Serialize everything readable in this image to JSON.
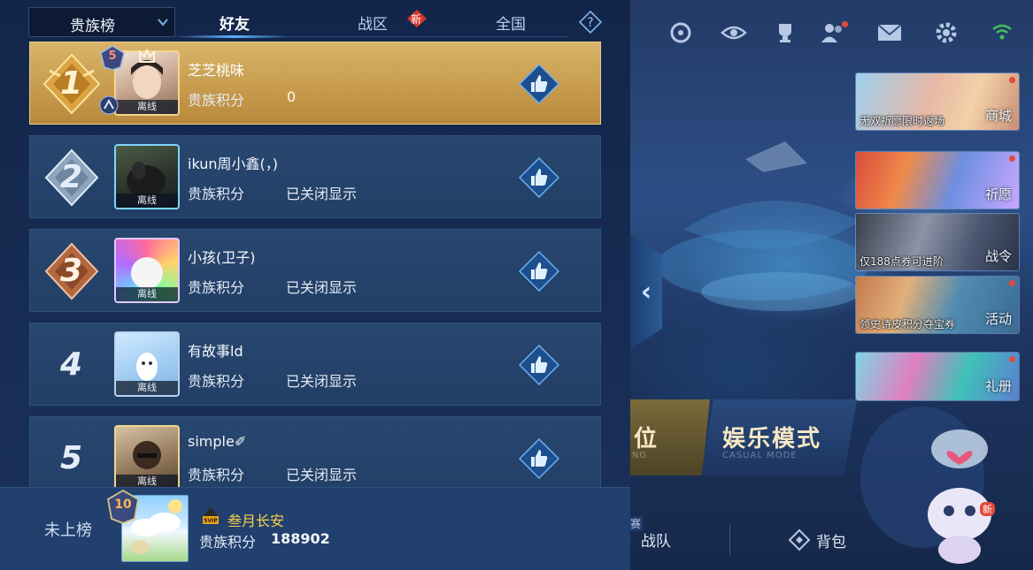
{
  "header": {
    "board_select": "贵族榜",
    "tabs": [
      {
        "label": "好友",
        "active": true
      },
      {
        "label": "战区",
        "active": false,
        "badge": "新"
      },
      {
        "label": "全国",
        "active": false
      }
    ]
  },
  "rows": [
    {
      "rank": "1",
      "name": "芝芝桃味",
      "score_label": "贵族积分",
      "score": "0",
      "status": "离线",
      "level_badge": "5"
    },
    {
      "rank": "2",
      "name": "ikun周小鑫(，)",
      "score_label": "贵族积分",
      "score": "已关闭显示",
      "status": "离线"
    },
    {
      "rank": "3",
      "name": "小孩(卫子)",
      "score_label": "贵族积分",
      "score": "已关闭显示",
      "status": "离线"
    },
    {
      "rank": "4",
      "name": "有故事ld",
      "score_label": "贵族积分",
      "score": "已关闭显示",
      "status": "离线"
    },
    {
      "rank": "5",
      "name": "simple✐",
      "score_label": "贵族积分",
      "score": "已关闭显示",
      "status": "离线"
    }
  ],
  "my_entry": {
    "rank_text": "未上榜",
    "name": "叁月长安",
    "score_label": "贵族积分",
    "score": "188902",
    "level_badge": "10",
    "vip": "5VIP"
  },
  "right_panel": {
    "cards": [
      {
        "caption": "无双祈愿限时返场",
        "label": "商城"
      },
      {
        "caption": "",
        "label": "祈愿"
      },
      {
        "caption": "仅188点券可进阶",
        "label": "战令"
      },
      {
        "caption": "领史诗皮积分夺宝券",
        "label": "活动"
      },
      {
        "caption": "",
        "label": "礼册"
      }
    ],
    "modes": [
      {
        "title": "位",
        "sub": "NG"
      },
      {
        "title": "娱乐模式",
        "sub": "CASUAL MODE"
      }
    ],
    "nav": [
      {
        "label": "战队",
        "tag": "赛"
      },
      {
        "label": "背包"
      }
    ],
    "mascot_badge": "新"
  },
  "colors": {
    "gold_row": "#c69a4c",
    "row_bg": "#223f66",
    "accent_blue": "#5fb2ff",
    "name_gold": "#ffcf4a"
  }
}
